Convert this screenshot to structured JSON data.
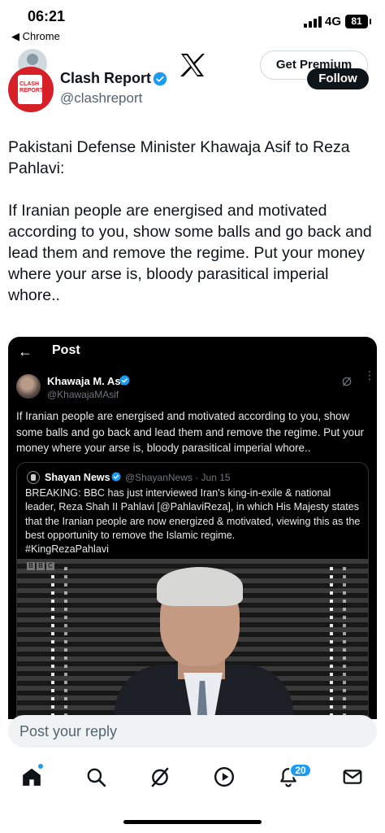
{
  "status_bar": {
    "time": "06:21",
    "back_app": "◀ Chrome",
    "network": "4G",
    "battery": "81"
  },
  "author": {
    "name": "Clash Report",
    "handle": "@clashreport",
    "avatar_text": "CLASH REPORT",
    "verified_color": "#1d9bf0",
    "brand_color": "#d61f26"
  },
  "header": {
    "premium_label": "Get Premium",
    "follow_label": "Follow",
    "logo_icon": "x-logo-icon"
  },
  "tweet": {
    "text": "Pakistani Defense Minister Khawaja Asif to Reza Pahlavi:\n\nIf Iranian people are energised and motivated according to you, show some balls and go back and lead them and remove the regime. Put your money where your arse is, bloody parasitical imperial whore.."
  },
  "embed": {
    "back_icon": "arrow-left-icon",
    "title": "Post",
    "inner_post": {
      "name": "Khawaja M. Asif",
      "handle": "@KhawajaMAsif",
      "text": "If Iranian people are energised and motivated according to you, show some balls and go back and lead them and remove the regime. Put your money where your arse is, bloody parasitical imperial whore.."
    },
    "quote": {
      "name": "Shayan News",
      "handle": "@ShayanNews · Jun 15",
      "text": "BREAKING: BBC has just interviewed Iran's king-in-exile & national leader, Reza Shah II Pahlavi [@PahlaviReza], in which His Majesty states that the Iranian people are now energized & motivated, viewing this as the best opportunity to remove the Islamic regime.\n#KingRezaPahlavi",
      "video_logo": [
        "B",
        "B",
        "C"
      ]
    }
  },
  "reply": {
    "placeholder": "Post your reply"
  },
  "nav": {
    "items": [
      "home-icon",
      "search-icon",
      "grok-icon",
      "play-icon",
      "notifications-icon",
      "messages-icon"
    ],
    "notification_count": "20",
    "accent": "#1d9bf0"
  }
}
